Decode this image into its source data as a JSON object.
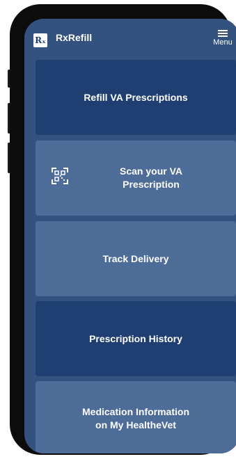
{
  "app": {
    "title": "RxRefill",
    "logo_text": "Rₓ",
    "menu_label": "Menu",
    "menu_icon": "hamburger-icon"
  },
  "tiles": [
    {
      "label": "Refill VA Prescriptions",
      "style": "dark"
    },
    {
      "label": "Scan your VA\nPrescription",
      "style": "light",
      "icon": "qr-scan-icon"
    },
    {
      "label": "Track Delivery",
      "style": "light"
    },
    {
      "label": "Prescription History",
      "style": "dark"
    },
    {
      "label": "Medication Information\non My HealtheVet",
      "style": "light"
    }
  ],
  "colors": {
    "phone_frame": "#0c0c0c",
    "app_background": "#33527f",
    "tile_dark": "#1f3f72",
    "tile_light": "#4e6c98",
    "text": "#ffffff"
  }
}
